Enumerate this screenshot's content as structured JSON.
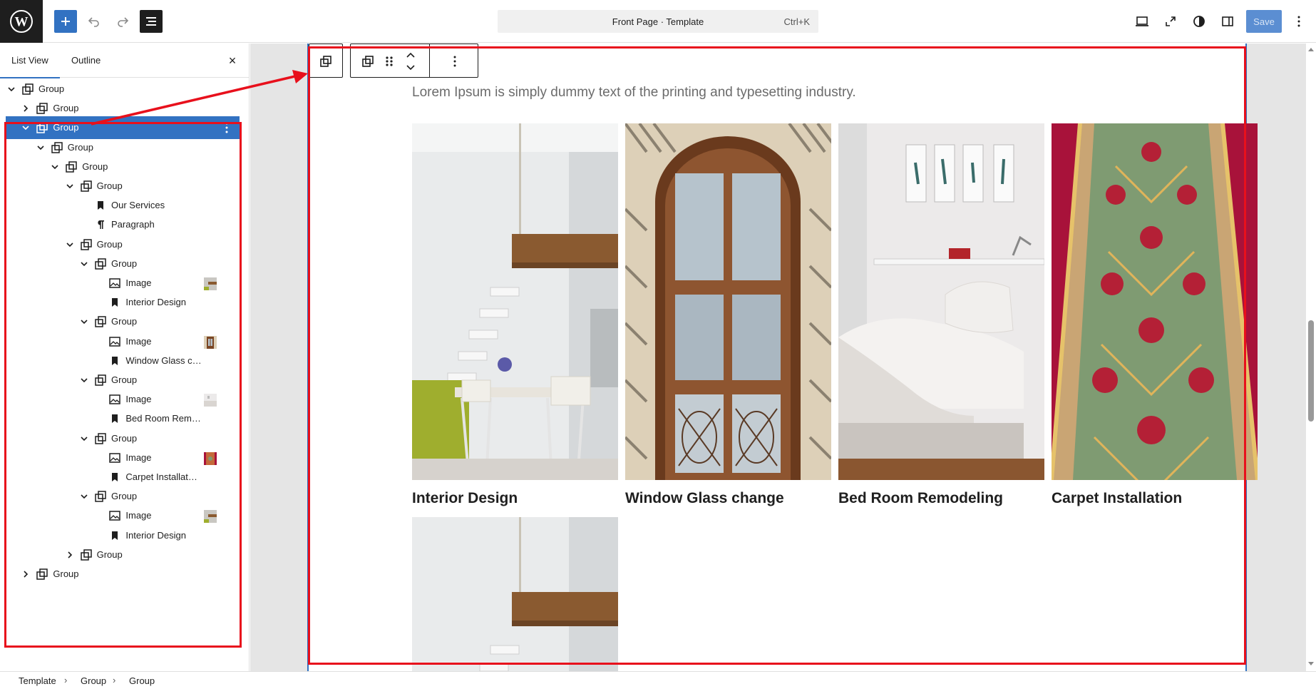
{
  "topbar": {
    "command_title": "Front Page · Template",
    "command_shortcut": "Ctrl+K",
    "save_label": "Save"
  },
  "sidebar": {
    "tabs": [
      "List View",
      "Outline"
    ],
    "close_glyph": "×",
    "rows": [
      {
        "label": "Group",
        "icon": "group-icon",
        "chevron": "down"
      },
      {
        "label": "Group",
        "icon": "group-icon",
        "chevron": "right"
      },
      {
        "label": "Group",
        "icon": "group-icon",
        "chevron": "down",
        "selected": true
      },
      {
        "label": "Group",
        "icon": "group-icon",
        "chevron": "down"
      },
      {
        "label": "Group",
        "icon": "group-icon",
        "chevron": "down"
      },
      {
        "label": "Group",
        "icon": "group-icon",
        "chevron": "down"
      },
      {
        "label": "Our Services",
        "icon": "heading-icon"
      },
      {
        "label": "Paragraph",
        "icon": "paragraph-icon"
      },
      {
        "label": "Group",
        "icon": "group-icon",
        "chevron": "down"
      },
      {
        "label": "Group",
        "icon": "group-icon",
        "chevron": "down"
      },
      {
        "label": "Image",
        "icon": "image-icon",
        "thumb": "interior"
      },
      {
        "label": "Interior Design",
        "icon": "heading-icon"
      },
      {
        "label": "Group",
        "icon": "group-icon",
        "chevron": "down"
      },
      {
        "label": "Image",
        "icon": "image-icon",
        "thumb": "window"
      },
      {
        "label": "Window Glass c…",
        "icon": "heading-icon"
      },
      {
        "label": "Group",
        "icon": "group-icon",
        "chevron": "down"
      },
      {
        "label": "Image",
        "icon": "image-icon",
        "thumb": "bedroom"
      },
      {
        "label": "Bed Room Rem…",
        "icon": "heading-icon"
      },
      {
        "label": "Group",
        "icon": "group-icon",
        "chevron": "down"
      },
      {
        "label": "Image",
        "icon": "image-icon",
        "thumb": "carpet"
      },
      {
        "label": "Carpet Installat…",
        "icon": "heading-icon"
      },
      {
        "label": "Group",
        "icon": "group-icon",
        "chevron": "down"
      },
      {
        "label": "Image",
        "icon": "image-icon",
        "thumb": "interior"
      },
      {
        "label": "Interior Design",
        "icon": "heading-icon"
      },
      {
        "label": "Group",
        "icon": "group-icon",
        "chevron": "right"
      },
      {
        "label": "Group",
        "icon": "group-icon",
        "chevron": "right"
      }
    ]
  },
  "canvas": {
    "lead_text": "Lorem Ipsum is simply dummy text of the printing and typesetting industry.",
    "cards": [
      {
        "title": "Interior Design",
        "image": "interior"
      },
      {
        "title": "Window Glass change",
        "image": "window"
      },
      {
        "title": "Bed Room Remodeling",
        "image": "bedroom"
      },
      {
        "title": "Carpet Installation",
        "image": "carpet"
      }
    ]
  },
  "breadcrumb": [
    "Template",
    "Group",
    "Group"
  ],
  "colors": {
    "accent": "#3272c2",
    "annotation": "#e8101c",
    "fab": "#55d08e"
  }
}
